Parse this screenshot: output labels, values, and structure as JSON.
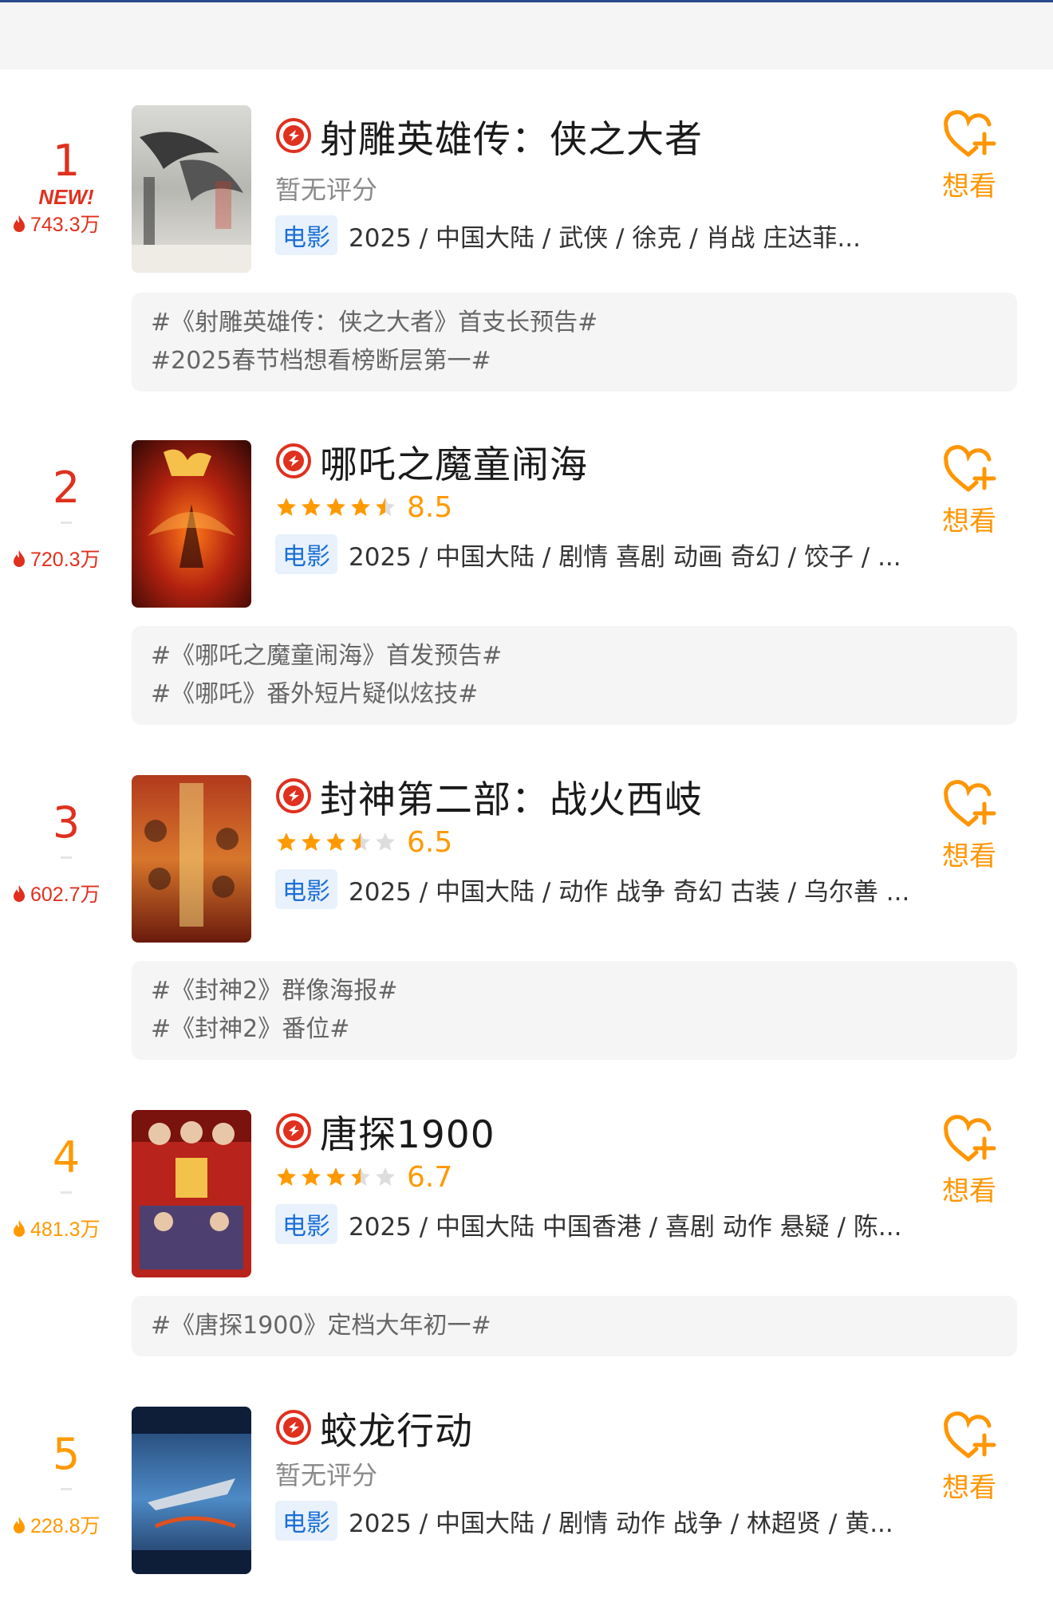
{
  "colors": {
    "rank_red": "#e0301e",
    "rank_orange": "#ff9900",
    "accent_orange": "#ff9500",
    "tag_blue": "#1a6fd6",
    "tag_bg": "#e8f1fc",
    "topic_bg": "#f5f5f5",
    "badge_red": "#e0301e"
  },
  "icons": {
    "flame": "flame-icon",
    "want": "heart-plus-icon",
    "badge": "movie-badge-icon",
    "star": "star-icon"
  },
  "items": [
    {
      "rank": "1",
      "new_label": "NEW!",
      "heat": "743.3万",
      "title": "射雕英雄传：侠之大者",
      "rating_text": "暂无评分",
      "stars": null,
      "score": "",
      "type": "电影",
      "meta": "2025 / 中国大陆 / 武侠 / 徐克 / 肖战 庄达菲...",
      "want_label": "想看",
      "topics": [
        "#《射雕英雄传：侠之大者》首支长预告#",
        "#2025春节档想看榜断层第一#"
      ]
    },
    {
      "rank": "2",
      "new_label": "",
      "heat": "720.3万",
      "title": "哪吒之魔童闹海",
      "rating_text": "",
      "stars": 4.5,
      "score": "8.5",
      "type": "电影",
      "meta": "2025 / 中国大陆 / 剧情 喜剧 动画 奇幻 / 饺子 / ...",
      "want_label": "想看",
      "topics": [
        "#《哪吒之魔童闹海》首发预告#",
        "#《哪吒》番外短片疑似炫技#"
      ]
    },
    {
      "rank": "3",
      "new_label": "",
      "heat": "602.7万",
      "title": "封神第二部：战火西岐",
      "rating_text": "",
      "stars": 3.5,
      "score": "6.5",
      "type": "电影",
      "meta": "2025 / 中国大陆 / 动作 战争 奇幻 古装 / 乌尔善 ...",
      "want_label": "想看",
      "topics": [
        "#《封神2》群像海报#",
        "#《封神2》番位#"
      ]
    },
    {
      "rank": "4",
      "new_label": "",
      "heat": "481.3万",
      "title": "唐探1900",
      "rating_text": "",
      "stars": 3.5,
      "score": "6.7",
      "type": "电影",
      "meta": "2025 / 中国大陆 中国香港 / 喜剧 动作 悬疑 / 陈...",
      "want_label": "想看",
      "topics": [
        "#《唐探1900》定档大年初一#"
      ]
    },
    {
      "rank": "5",
      "new_label": "",
      "heat": "228.8万",
      "title": "蛟龙行动",
      "rating_text": "暂无评分",
      "stars": null,
      "score": "",
      "type": "电影",
      "meta": "2025 / 中国大陆 / 剧情 动作 战争 / 林超贤 / 黄...",
      "want_label": "想看",
      "topics": []
    }
  ]
}
